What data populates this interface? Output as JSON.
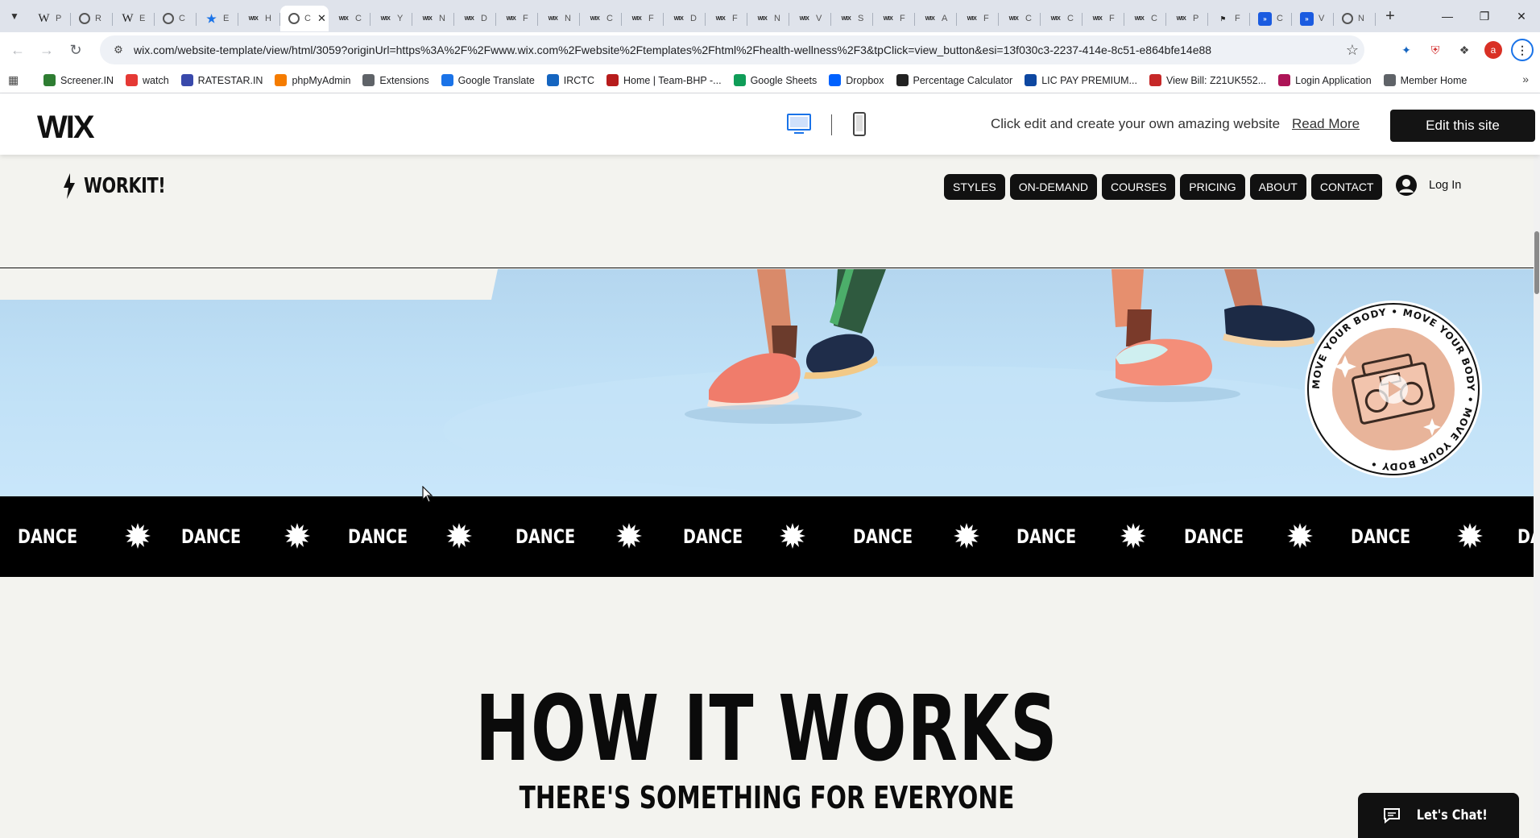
{
  "browser": {
    "tabs": [
      {
        "icon": "wikipedia",
        "letter": "P"
      },
      {
        "icon": "openai",
        "letter": "R"
      },
      {
        "icon": "wikipedia",
        "letter": "E"
      },
      {
        "icon": "globe",
        "letter": "C"
      },
      {
        "icon": "star",
        "letter": "E"
      },
      {
        "icon": "wix",
        "letter": "H"
      },
      {
        "icon": "active",
        "letter": "C"
      },
      {
        "icon": "wix",
        "letter": "C"
      },
      {
        "icon": "wix",
        "letter": "Y"
      },
      {
        "icon": "wix",
        "letter": "N"
      },
      {
        "icon": "wix",
        "letter": "D"
      },
      {
        "icon": "wix",
        "letter": "F"
      },
      {
        "icon": "wix",
        "letter": "N"
      },
      {
        "icon": "wix",
        "letter": "C"
      },
      {
        "icon": "wix",
        "letter": "F"
      },
      {
        "icon": "wix",
        "letter": "D"
      },
      {
        "icon": "wix",
        "letter": "F"
      },
      {
        "icon": "wix",
        "letter": "N"
      },
      {
        "icon": "wix",
        "letter": "V"
      },
      {
        "icon": "wix",
        "letter": "S"
      },
      {
        "icon": "wix",
        "letter": "F"
      },
      {
        "icon": "wix",
        "letter": "A"
      },
      {
        "icon": "wix",
        "letter": "F"
      },
      {
        "icon": "wix",
        "letter": "C"
      },
      {
        "icon": "wix",
        "letter": "C"
      },
      {
        "icon": "wix",
        "letter": "F"
      },
      {
        "icon": "wix",
        "letter": "C"
      },
      {
        "icon": "wix",
        "letter": "P"
      },
      {
        "icon": "flag",
        "letter": "F"
      },
      {
        "icon": "blue",
        "letter": "C"
      },
      {
        "icon": "blue",
        "letter": "V"
      },
      {
        "icon": "globe",
        "letter": "N"
      }
    ],
    "url": "wix.com/website-template/view/html/3059?originUrl=https%3A%2F%2Fwww.wix.com%2Fwebsite%2Ftemplates%2Fhtml%2Fhealth-wellness%2F3&tpClick=view_button&esi=13f030c3-2237-414e-8c51-e864bfe14e88",
    "profile_letter": "a",
    "bookmarks": [
      {
        "label": "Screener.IN",
        "color": "#2e7d32"
      },
      {
        "label": "watch",
        "color": "#e53935"
      },
      {
        "label": "RATESTAR.IN",
        "color": "#3949ab"
      },
      {
        "label": "phpMyAdmin",
        "color": "#f57c00"
      },
      {
        "label": "Extensions",
        "color": "#5f6368"
      },
      {
        "label": "Google Translate",
        "color": "#1a73e8"
      },
      {
        "label": "IRCTC",
        "color": "#1565c0"
      },
      {
        "label": "Home | Team-BHP -...",
        "color": "#b71c1c"
      },
      {
        "label": "Google Sheets",
        "color": "#0f9d58"
      },
      {
        "label": "Dropbox",
        "color": "#0061fe"
      },
      {
        "label": "Percentage Calculator",
        "color": "#222222"
      },
      {
        "label": "LIC PAY PREMIUM...",
        "color": "#0d47a1"
      },
      {
        "label": "View Bill: Z21UK552...",
        "color": "#c62828"
      },
      {
        "label": "Login Application",
        "color": "#ad1457"
      },
      {
        "label": "Member Home",
        "color": "#5f6368"
      }
    ]
  },
  "wixbar": {
    "logo": "WIX",
    "message": "Click edit and create your own amazing website",
    "read_more": "Read More",
    "edit_button": "Edit this site"
  },
  "site": {
    "brand": "WORKIT!",
    "nav": [
      "STYLES",
      "ON-DEMAND",
      "COURSES",
      "PRICING",
      "ABOUT",
      "CONTACT"
    ],
    "login": "Log In",
    "badge_text": "MOVE YOUR BODY",
    "marquee_word": "DANCE",
    "how_title": "HOW IT WORKS",
    "how_subtitle": "THERE'S SOMETHING FOR EVERYONE",
    "chat_label": "Let's Chat!"
  },
  "colors": {
    "page_bg": "#f3f3ef",
    "dark": "#111111",
    "hero_sky": "#bfe0f6",
    "badge": "#e8b49a"
  }
}
